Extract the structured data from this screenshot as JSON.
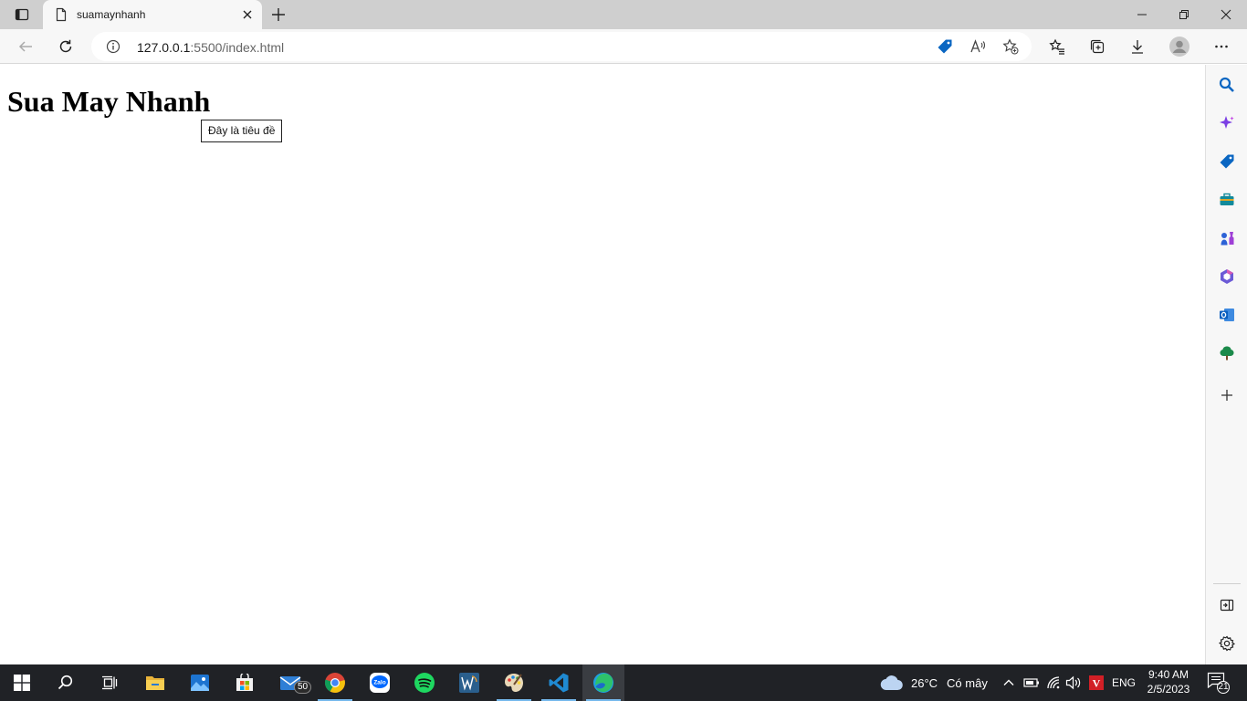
{
  "browser": {
    "tab": {
      "title": "suamaynhanh"
    },
    "address": {
      "host": "127.0.0.1",
      "rest": ":5500/index.html"
    }
  },
  "page": {
    "heading": "Sua May Nhanh",
    "tooltip": "Đây là tiêu đề"
  },
  "sidebar": {
    "items": [
      "search-icon",
      "copilot-icon",
      "shopping-icon",
      "tools-icon",
      "games-icon",
      "office-icon",
      "outlook-icon",
      "tree-icon",
      "add-icon"
    ]
  },
  "taskbar": {
    "mail_badge": "50",
    "weather": {
      "temp": "26°C",
      "condition": "Có mây"
    },
    "language": "ENG",
    "clock": {
      "time": "9:40 AM",
      "date": "2/5/2023"
    },
    "notifications": "21"
  },
  "colors": {
    "edge_blue": "#0a66c2",
    "taskbar": "#202226",
    "tab_strip": "#cfcfcf"
  }
}
